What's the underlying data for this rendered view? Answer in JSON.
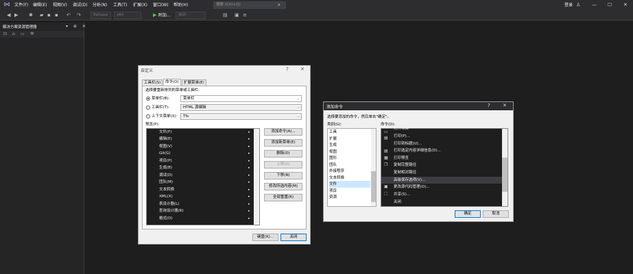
{
  "menu": {
    "items": [
      "文件(F)",
      "编辑(E)",
      "视图(V)",
      "调试(D)",
      "分析(N)",
      "工具(T)",
      "扩展(X)",
      "窗口(W)",
      "帮助(H)"
    ],
    "search_placeholder": "搜索 (Ctrl+Q)",
    "login": "登录"
  },
  "toolbar": {
    "config": "Release",
    "platform": "x64",
    "attach": "附加...",
    "target": "自动"
  },
  "solution_explorer": {
    "title": "解决方案资源管理器",
    "pin_controls": "▾ ⊕ ✕"
  },
  "customize_dialog": {
    "title": "自定义",
    "help": "?",
    "tabs": [
      "工具栏(S)",
      "命令(O)",
      "扩展菜单(E)"
    ],
    "instruction": "选择要重新排列的菜单或工具栏:",
    "radio_menubar": "菜单栏(B):",
    "radio_toolbar": "工具栏(T):",
    "radio_context": "上下文菜单(X):",
    "combo_menubar": "菜单栏",
    "combo_toolbar": "HTML 源编辑",
    "combo_context": "Tfs",
    "preview_label": "预览(P):",
    "preview_items": [
      "文件(F)",
      "编辑(E)",
      "视图(V)",
      "Git(G)",
      "项目(P)",
      "生成(B)",
      "调试(D)",
      "团队(M)",
      "文本转换",
      "XML(X)",
      "表设计器(L)",
      "查询设计器(R)",
      "格式(O)"
    ],
    "buttons": [
      "添加命令(A)...",
      "添加新菜单(E)",
      "删除(D)",
      "上移(U)",
      "下移(N)",
      "修改所选内容(M)",
      "全部重置(R)"
    ],
    "keyboard_button": "键盘(K)...",
    "close_button": "关闭"
  },
  "add_command_dialog": {
    "title": "添加命令",
    "help": "?",
    "instruction": "选择要添加的命令，然后单击\"确定\"。",
    "categories_label": "类别(G):",
    "commands_label": "命令(D):",
    "categories": [
      "工具",
      "扩展",
      "生成",
      "视图",
      "图形",
      "团队",
      "外接程序",
      "文本转换",
      "文件",
      "项目",
      "资源"
    ],
    "selected_category": "文件",
    "commands": [
      "打开项目",
      "打印(P)...",
      "打印到标题(U)...",
      "打印选定内容详细信息(D)...",
      "打印预览",
      "复制完整路径",
      "复制相对路径",
      "高级保存选项(V)...",
      "更改源代码管理(O)...",
      "共享(S)...",
      "关闭"
    ],
    "selected_command": "高级保存选项(V)...",
    "ok_button": "确定",
    "cancel_button": "取消"
  }
}
